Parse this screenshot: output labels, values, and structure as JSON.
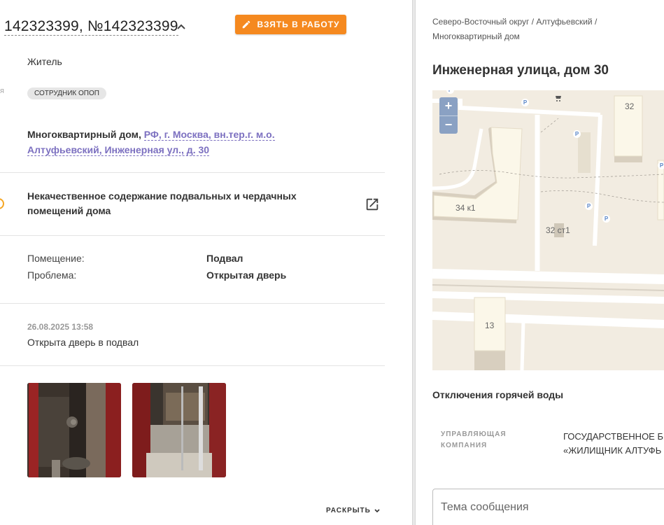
{
  "ticket": {
    "title": "142323399, №142323399",
    "take_button": "ВЗЯТЬ В РАБОТУ",
    "applicant_type": "Житель",
    "side_fragment": "я",
    "role_chip": "СОТРУДНИК ОПОП",
    "address_prefix": "Многоквартирный дом,",
    "address_link": "РФ, г. Москва, вн.тер.г. м.о. Алтуфьевский, Инженерная ул., д. 30",
    "category": "Некачественное содержание подвальных и чердачных помещений дома",
    "details": [
      {
        "label": "Помещение:",
        "value": "Подвал"
      },
      {
        "label": "Проблема:",
        "value": "Открытая дверь"
      }
    ],
    "message_date": "26.08.2025 13:58",
    "message_text": "Открыта дверь в подвал",
    "expand_label": "РАСКРЫТЬ"
  },
  "building": {
    "breadcrumb": "Северо-Восточный округ / Алтуфьевский / Многоквартирный дом",
    "title": "Инженерная улица, дом 30",
    "hot_water_heading": "Отключения горячей воды",
    "mc_label": "УПРАВЛЯЮЩАЯ КОМПАНИЯ",
    "mc_value_line1": "ГОСУДАРСТВЕННОЕ Б",
    "mc_value_line2": "«ЖИЛИЩНИК АЛТУФЬ",
    "subject_placeholder": "Тема сообщения"
  },
  "map": {
    "zoom_in": "+",
    "zoom_out": "−",
    "labels": [
      "32",
      "34 к1",
      "32 ст1",
      "13"
    ],
    "parking": "P"
  },
  "colors": {
    "accent": "#f5891f",
    "link": "#7c70c0",
    "status": "#f5a623"
  }
}
